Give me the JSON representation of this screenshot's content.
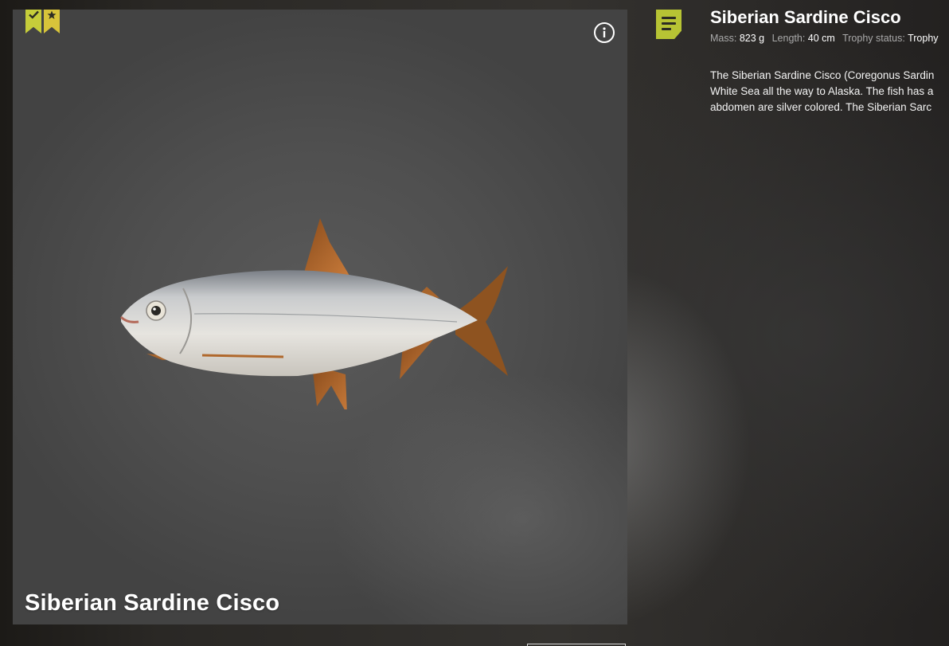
{
  "card": {
    "title": "Siberian Sardine Cisco",
    "badges": [
      {
        "icon": "checkmark-icon",
        "color": "#c6cd3a"
      },
      {
        "icon": "star-icon",
        "color": "#d8c43a"
      }
    ],
    "info_icon": "info-icon"
  },
  "detail": {
    "notes_icon": "notes-icon",
    "title": "Siberian Sardine Cisco",
    "mass_label": "Mass:",
    "mass_value": "823 g",
    "length_label": "Length:",
    "length_value": "40 cm",
    "trophy_label": "Trophy status:",
    "trophy_value": "Trophy",
    "description_lines": [
      "The Siberian Sardine Cisco (Coregonus Sardin",
      "White Sea all the way to Alaska. The fish has a",
      "abdomen are silver colored. The Siberian Sarc"
    ]
  },
  "colors": {
    "accent": "#c6cd3a",
    "accent_star": "#d8c43a",
    "notes_accent": "#b7c434"
  }
}
